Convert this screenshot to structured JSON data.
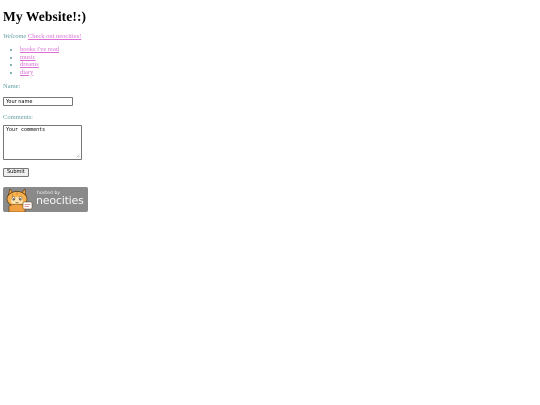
{
  "page": {
    "title": "My Website!:)",
    "welcome_label": "Welcome",
    "neocities_link": "Check out neocities!"
  },
  "nav": {
    "items": [
      {
        "label": "books i've read"
      },
      {
        "label": "music"
      },
      {
        "label": "dreams"
      },
      {
        "label": "diary"
      }
    ]
  },
  "form": {
    "name_label": "Name:",
    "name_value": "Your name",
    "comments_label": "Comments:",
    "comments_value": "Your comments",
    "submit_label": "Submit"
  },
  "badge": {
    "hosted_by": "hosted by",
    "name": "neocities"
  },
  "colors": {
    "text": "#5f9ea0",
    "link": "#da70d6",
    "heading": "#000000",
    "badge_bg": "#8a8a8a",
    "cat_orange": "#f0a040"
  },
  "icons": {
    "badge_mascot": "cat-icon"
  }
}
